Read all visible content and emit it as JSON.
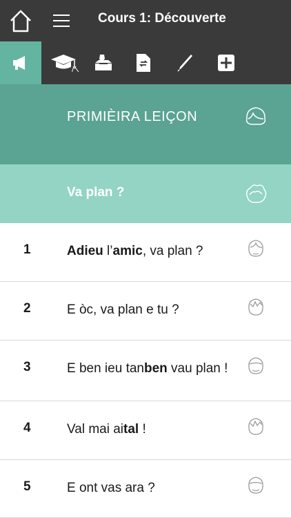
{
  "header": {
    "title": "Cours 1: Découverte"
  },
  "toolbar": {
    "tools": [
      {
        "name": "audio-tool",
        "active": true
      },
      {
        "name": "graduation-tool",
        "active": false
      },
      {
        "name": "vote-tool",
        "active": false
      },
      {
        "name": "document-tool",
        "active": false
      },
      {
        "name": "pencil-tool",
        "active": false
      },
      {
        "name": "add-tool",
        "active": false
      }
    ]
  },
  "lesson": {
    "title": "PRIMIÈIRA LEIÇON",
    "subtitle": "Va plan ?"
  },
  "phrases": [
    {
      "number": "1",
      "parts": [
        {
          "t": "Adieu",
          "b": true
        },
        {
          "t": " l’",
          "b": false
        },
        {
          "t": "amic",
          "b": true
        },
        {
          "t": ", va plan ?",
          "b": false
        }
      ]
    },
    {
      "number": "2",
      "parts": [
        {
          "t": "E òc, va plan e tu ?",
          "b": false
        }
      ]
    },
    {
      "number": "3",
      "parts": [
        {
          "t": "E ben ieu tan",
          "b": false
        },
        {
          "t": "ben",
          "b": true
        },
        {
          "t": " vau plan !",
          "b": false
        }
      ]
    },
    {
      "number": "4",
      "parts": [
        {
          "t": "Val mai ai",
          "b": false
        },
        {
          "t": "tal",
          "b": true
        },
        {
          "t": " !",
          "b": false
        }
      ]
    },
    {
      "number": "5",
      "parts": [
        {
          "t": "E ont vas ara ?",
          "b": false
        }
      ]
    }
  ],
  "colors": {
    "bar": "#3a3a3a",
    "active_tool": "#63b5a2",
    "section": "#5ba393",
    "subsection": "#93d4c4"
  }
}
